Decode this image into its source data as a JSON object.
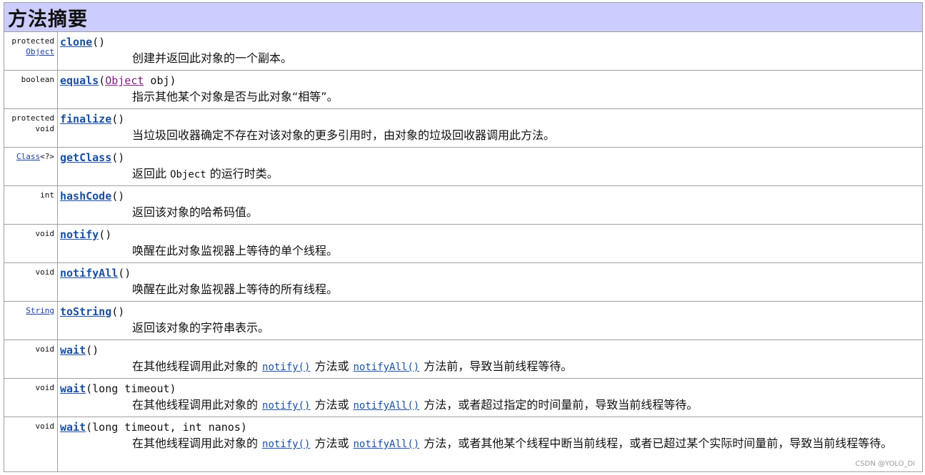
{
  "header": {
    "title": "方法摘要"
  },
  "rows": [
    {
      "mod1": "protected",
      "mod2": "Object",
      "name": "clone",
      "params": "()",
      "desc": "创建并返回此对象的一个副本。"
    },
    {
      "mod1": "boolean",
      "name": "equals",
      "param_open": "(",
      "param_type": "Object",
      "param_rest": " obj)",
      "desc": "指示其他某个对象是否与此对象“相等”。"
    },
    {
      "mod1": "protected",
      "mod2": "void",
      "name": "finalize",
      "params": "()",
      "desc": "当垃圾回收器确定不存在对该对象的更多引用时，由对象的垃圾回收器调用此方法。"
    },
    {
      "mod_link": "Class",
      "mod_rest": "<?>",
      "name": "getClass",
      "params": "()",
      "desc_a": "返回此",
      "desc_code": "Object",
      "desc_b": "的运行时类。"
    },
    {
      "mod1": "int",
      "name": "hashCode",
      "params": "()",
      "desc": "返回该对象的哈希码值。"
    },
    {
      "mod1": "void",
      "name": "notify",
      "params": "()",
      "desc": "唤醒在此对象监视器上等待的单个线程。"
    },
    {
      "mod1": "void",
      "name": "notifyAll",
      "params": "()",
      "desc": "唤醒在此对象监视器上等待的所有线程。"
    },
    {
      "mod_link": "String",
      "name": "toString",
      "params": "()",
      "desc": "返回该对象的字符串表示。"
    },
    {
      "mod1": "void",
      "name": "wait",
      "params": "()",
      "desc_a": "在其他线程调用此对象的",
      "link1": "notify()",
      "desc_b": "方法或",
      "link2": "notifyAll()",
      "desc_c": "方法前，导致当前线程等待。"
    },
    {
      "mod1": "void",
      "name": "wait",
      "params": "(long timeout)",
      "desc_a": "在其他线程调用此对象的",
      "link1": "notify()",
      "desc_b": "方法或",
      "link2": "notifyAll()",
      "desc_c": "方法，或者超过指定的时间量前，导致当前线程等待。"
    },
    {
      "mod1": "void",
      "name": "wait",
      "params": "(long timeout, int nanos)",
      "desc_a": "在其他线程调用此对象的",
      "link1": "notify()",
      "desc_b": "方法或",
      "link2": "notifyAll()",
      "desc_c": "方法，或者其他某个线程中断当前线程，或者已超过某个实际时间量前，导致当前线程等待。"
    }
  ],
  "watermark": "CSDN @YOLO_Di"
}
